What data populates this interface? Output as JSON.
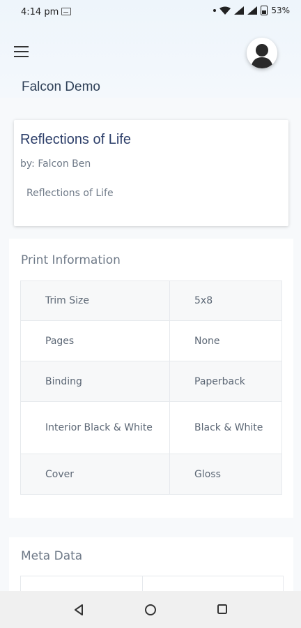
{
  "status_bar": {
    "time": "4:14 pm",
    "battery_percent": "53%"
  },
  "app": {
    "title": "Falcon Demo"
  },
  "book": {
    "title": "Reflections of Life",
    "author": "by: Falcon Ben",
    "description": "Reflections of Life"
  },
  "print_information": {
    "heading": "Print Information",
    "rows": [
      {
        "label": "Trim Size",
        "value": "5x8"
      },
      {
        "label": "Pages",
        "value": "None"
      },
      {
        "label": "Binding",
        "value": "Paperback"
      },
      {
        "label": "Interior Black & White",
        "value": "Black & White"
      },
      {
        "label": "Cover",
        "value": "Gloss"
      }
    ]
  },
  "meta_data": {
    "heading": "Meta Data"
  },
  "icons": {
    "menu": "menu-icon",
    "avatar": "avatar-icon",
    "back": "back-icon",
    "home": "home-icon",
    "recent": "recent-apps-icon"
  }
}
